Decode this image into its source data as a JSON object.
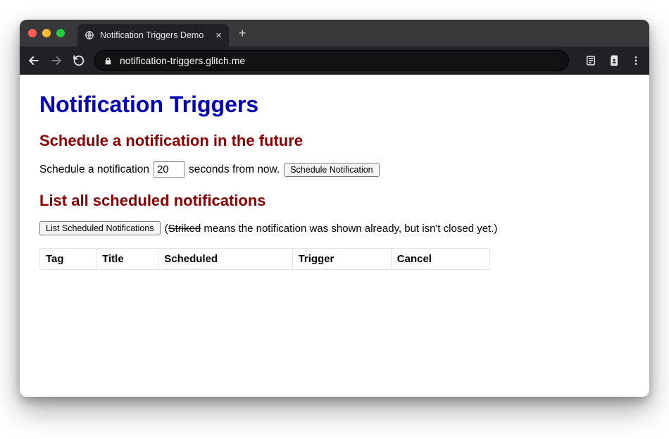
{
  "chrome": {
    "tab_title": "Notification Triggers Demo",
    "url": "notification-triggers.glitch.me"
  },
  "page": {
    "title": "Notification Triggers",
    "section_schedule": {
      "heading": "Schedule a notification in the future",
      "prefix": "Schedule a notification",
      "seconds_value": "20",
      "suffix": "seconds from now.",
      "button_label": "Schedule Notification"
    },
    "section_list": {
      "heading": "List all scheduled notifications",
      "button_label": "List Scheduled Notifications",
      "hint_open": "(",
      "hint_striked": "Striked",
      "hint_rest": " means the notification was shown already, but isn't closed yet.)",
      "columns": {
        "tag": "Tag",
        "title": "Title",
        "scheduled": "Scheduled",
        "trigger": "Trigger",
        "cancel": "Cancel"
      }
    }
  }
}
